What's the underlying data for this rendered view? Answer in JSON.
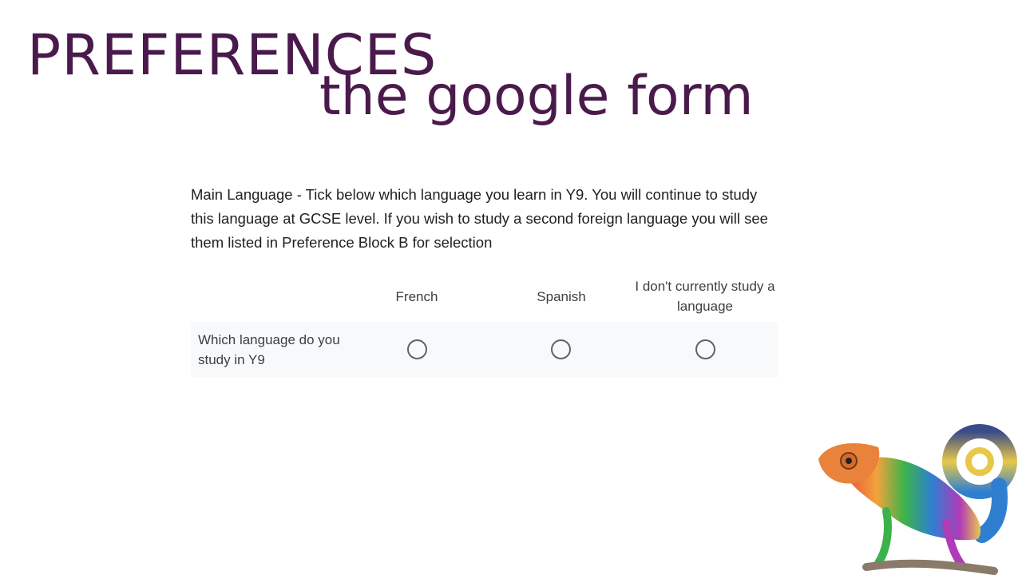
{
  "slide": {
    "title_line1": "PREFERENCES",
    "title_line2": "the google form"
  },
  "form": {
    "question": "Main Language - Tick below which language you learn in Y9. You will continue to study this language at GCSE level. If you wish to study a second foreign language you will see them listed in Preference Block B for selection",
    "columns": [
      "French",
      "Spanish",
      "I don't currently study a language"
    ],
    "rows": [
      {
        "label": "Which language do you study in Y9",
        "selected": null
      }
    ]
  },
  "colors": {
    "title": "#4a1a4c",
    "row_background": "#f8f9fa",
    "radio_border": "#5f6368"
  },
  "icons": {
    "decoration": "chameleon-illustration"
  }
}
